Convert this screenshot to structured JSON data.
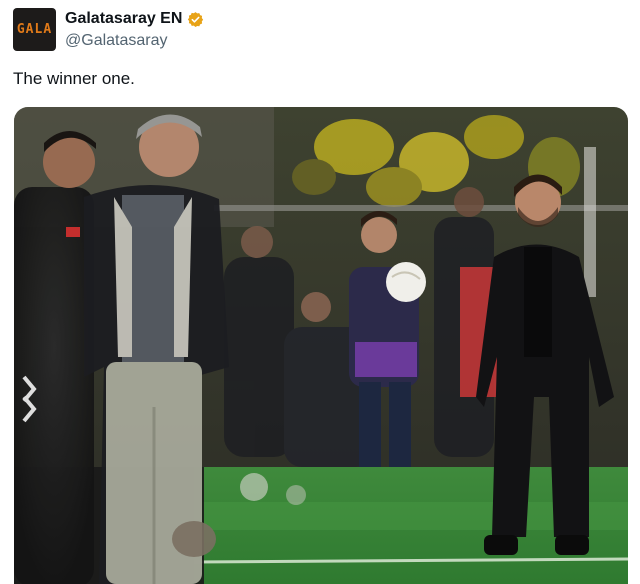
{
  "account": {
    "display_name": "Galatasaray EN",
    "handle": "@Galatasaray",
    "avatar_mark": "GALA",
    "verified_icon": "verified-badge-icon",
    "brand_colors": {
      "orange": "#e07a19",
      "yellow": "#f2c300",
      "badge": "#e8a317"
    }
  },
  "tweet": {
    "text": "The winner one."
  },
  "media": {
    "type": "photo",
    "description_icon": "photo-media"
  }
}
